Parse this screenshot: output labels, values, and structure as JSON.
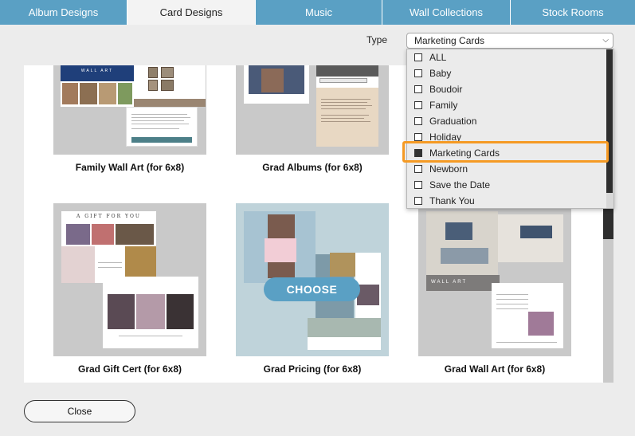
{
  "tabs": [
    {
      "label": "Album Designs",
      "active": false
    },
    {
      "label": "Card Designs",
      "active": true
    },
    {
      "label": "Music",
      "active": false
    },
    {
      "label": "Wall Collections",
      "active": false
    },
    {
      "label": "Stock Rooms",
      "active": false
    }
  ],
  "filter": {
    "label": "Type",
    "selected": "Marketing Cards",
    "options": [
      {
        "label": "ALL",
        "checked": false
      },
      {
        "label": "Baby",
        "checked": false
      },
      {
        "label": "Boudoir",
        "checked": false
      },
      {
        "label": "Family",
        "checked": false
      },
      {
        "label": "Graduation",
        "checked": false
      },
      {
        "label": "Holiday",
        "checked": false
      },
      {
        "label": "Marketing Cards",
        "checked": true
      },
      {
        "label": "Newborn",
        "checked": false
      },
      {
        "label": "Save the Date",
        "checked": false
      },
      {
        "label": "Thank You",
        "checked": false
      }
    ]
  },
  "cards": [
    {
      "title": "Family Wall Art (for 6x8)"
    },
    {
      "title": "Grad Albums (for 6x8)"
    },
    {
      "title": "Grad Gift Cert (for 6x8)"
    },
    {
      "title": "Grad Pricing (for 6x8)"
    },
    {
      "title": "Grad Wall Art (for 6x8)"
    }
  ],
  "thumb_text": {
    "wall_art": "WALL ART",
    "gift": "A GIFT FOR YOU"
  },
  "choose_label": "CHOOSE",
  "close_label": "Close",
  "colors": {
    "tab_blue": "#5aa0c4",
    "highlight_orange": "#f59a24",
    "thumb_gray": "#c9c9c9",
    "scroll_dark": "#2e2e2e"
  }
}
